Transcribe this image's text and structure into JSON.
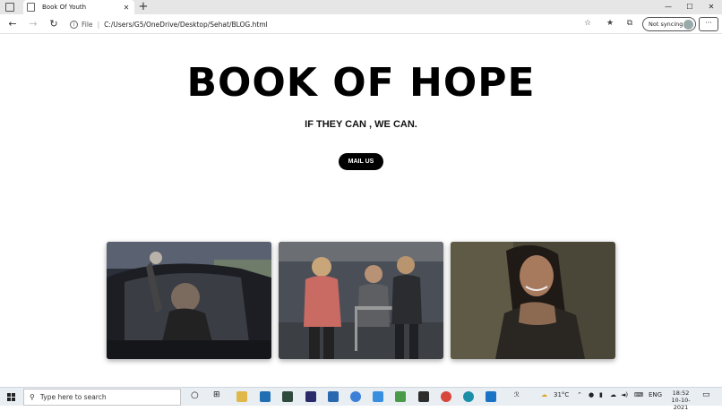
{
  "browser": {
    "tab_title": "Book Of Youth",
    "tab_close": "✕",
    "new_tab": "+",
    "window_buttons": [
      "—",
      "☐",
      "✕"
    ],
    "nav": {
      "back": "←",
      "forward": "→",
      "reload": "↻"
    },
    "address": {
      "info_icon": "i",
      "scheme_label": "File",
      "separator": "|",
      "url": "C:/Users/G5/OneDrive/Desktop/Sehat/BLOG.html"
    },
    "profile_label": "Not syncing",
    "menu": "···"
  },
  "page": {
    "title": "BOOK OF HOPE",
    "subtitle": "IF THEY CAN , WE CAN.",
    "mail_button": "MAIL US"
  },
  "taskbar": {
    "search_placeholder": "Type here to search",
    "weather": "31°C",
    "language": "ENG",
    "time": "18:52",
    "date": "10-10-2021"
  },
  "colors": {
    "accent": "#000000",
    "taskbar": "#e9eef3"
  }
}
